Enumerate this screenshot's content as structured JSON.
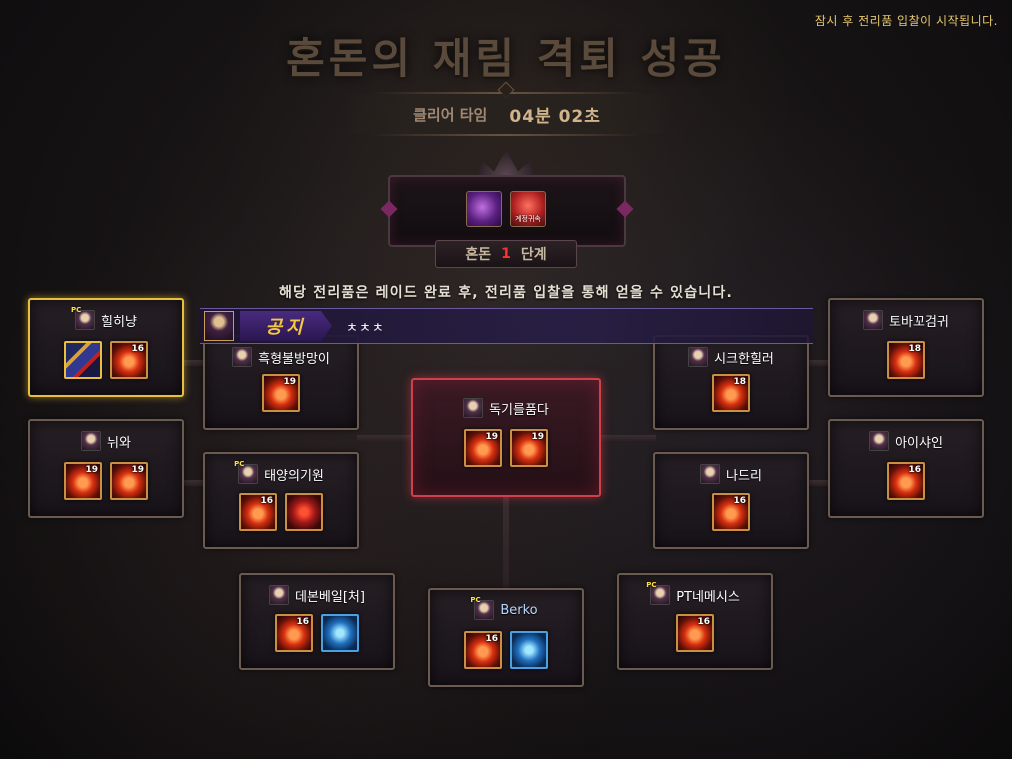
{
  "system_message": "잠시 후 전리품 입찰이 시작됩니다.",
  "title": "혼돈의 재림 격퇴 성공",
  "clear_time": {
    "label": "클리어 타임",
    "value": "04분 02초"
  },
  "emblem": {
    "icons": [
      "purple-rune-icon",
      "red-box-icon"
    ],
    "red_icon_label": "계정귀속"
  },
  "stage": {
    "mode": "혼돈",
    "number": "1",
    "unit": "단계"
  },
  "info_text": "해당 전리품은 레이드 완료 후, 전리품 입찰을 통해 얻을 수 있습니다.",
  "notice": {
    "tag": "공지",
    "text": "ㅊㅊㅊ"
  },
  "players": [
    {
      "name": "힐히냥",
      "pc": true,
      "items": [
        {
          "type": "weapon"
        },
        {
          "type": "fire",
          "level": "16"
        }
      ]
    },
    {
      "name": "뉘와",
      "pc": false,
      "items": [
        {
          "type": "fire",
          "level": "19"
        },
        {
          "type": "fire",
          "level": "19"
        }
      ]
    },
    {
      "name": "흑형불방망이",
      "pc": false,
      "items": [
        {
          "type": "fire",
          "level": "19"
        }
      ]
    },
    {
      "name": "태양의기원",
      "pc": true,
      "items": [
        {
          "type": "fire",
          "level": "16"
        },
        {
          "type": "demon"
        }
      ]
    },
    {
      "name": "독기를품다",
      "pc": false,
      "items": [
        {
          "type": "fire",
          "level": "19"
        },
        {
          "type": "fire",
          "level": "19"
        }
      ]
    },
    {
      "name": "시크한힐러",
      "pc": false,
      "items": [
        {
          "type": "fire",
          "level": "18"
        }
      ]
    },
    {
      "name": "나드리",
      "pc": false,
      "items": [
        {
          "type": "fire",
          "level": "16"
        }
      ]
    },
    {
      "name": "토바꼬검귀",
      "pc": false,
      "items": [
        {
          "type": "fire",
          "level": "18"
        }
      ]
    },
    {
      "name": "아이샤인",
      "pc": false,
      "items": [
        {
          "type": "fire",
          "level": "16"
        }
      ]
    },
    {
      "name": "데본베일[처]",
      "pc": false,
      "items": [
        {
          "type": "fire",
          "level": "16"
        },
        {
          "type": "blue"
        }
      ]
    },
    {
      "name": "Berko",
      "pc": true,
      "items": [
        {
          "type": "fire",
          "level": "16"
        },
        {
          "type": "blue"
        }
      ]
    },
    {
      "name": "PT네메시스",
      "pc": true,
      "items": [
        {
          "type": "fire",
          "level": "16"
        }
      ]
    }
  ]
}
